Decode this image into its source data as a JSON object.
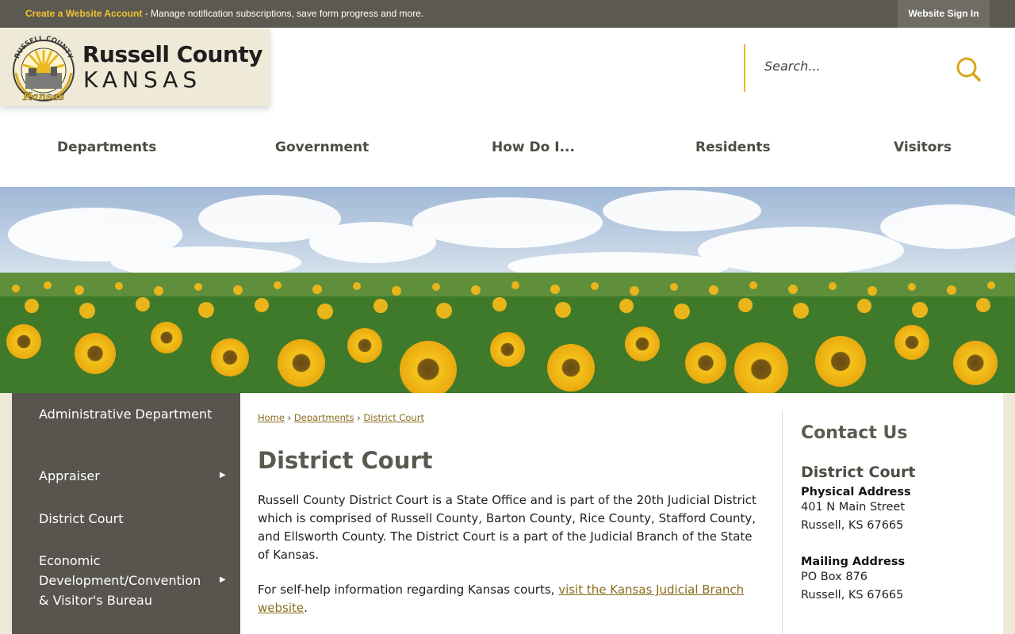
{
  "topbar": {
    "create_account": "Create a Website Account",
    "message": " - Manage notification subscriptions, save form progress and more.",
    "signin": "Website Sign In"
  },
  "logo": {
    "name": "Russell County",
    "state": "KANSAS",
    "seal_text_top": "RUSSELL COUNTY",
    "seal_text_bottom": "Kansas"
  },
  "search": {
    "placeholder": "Search..."
  },
  "nav": {
    "items": [
      "Departments",
      "Government",
      "How Do I...",
      "Residents",
      "Visitors"
    ]
  },
  "sidebar": {
    "items": [
      {
        "label": "Administrative Department",
        "has_submenu": false
      },
      {
        "label": "Appraiser",
        "has_submenu": true
      },
      {
        "label": "District Court",
        "has_submenu": false
      },
      {
        "label": "Economic Development/Convention & Visitor's Bureau",
        "has_submenu": true
      }
    ]
  },
  "breadcrumb": [
    "Home",
    "Departments",
    "District Court"
  ],
  "main": {
    "title": "District Court",
    "paragraph1": "Russell County District Court is a State Office and is part of the 20th Judicial District which is comprised of Russell County, Barton County, Rice County, Stafford County, and Ellsworth County. The District Court is a part of the Judicial Branch of the State of Kansas.",
    "paragraph2_prefix": "For self-help information regarding Kansas courts, ",
    "paragraph2_link": "visit the Kansas Judicial Branch website",
    "paragraph2_suffix": "."
  },
  "contact": {
    "heading": "Contact Us",
    "org": "District Court",
    "physical_label": "Physical Address",
    "physical_line1": "401 N Main Street",
    "physical_line2": "Russell, KS 67665",
    "mailing_label": "Mailing Address",
    "mailing_line1": "PO Box 876",
    "mailing_line2": "Russell, KS 67665"
  },
  "colors": {
    "topbar": "#5c5a50",
    "accent_gold": "#e8b923",
    "sidebar": "#57554d",
    "link": "#8a6c1c",
    "cream": "#efe9d7"
  }
}
